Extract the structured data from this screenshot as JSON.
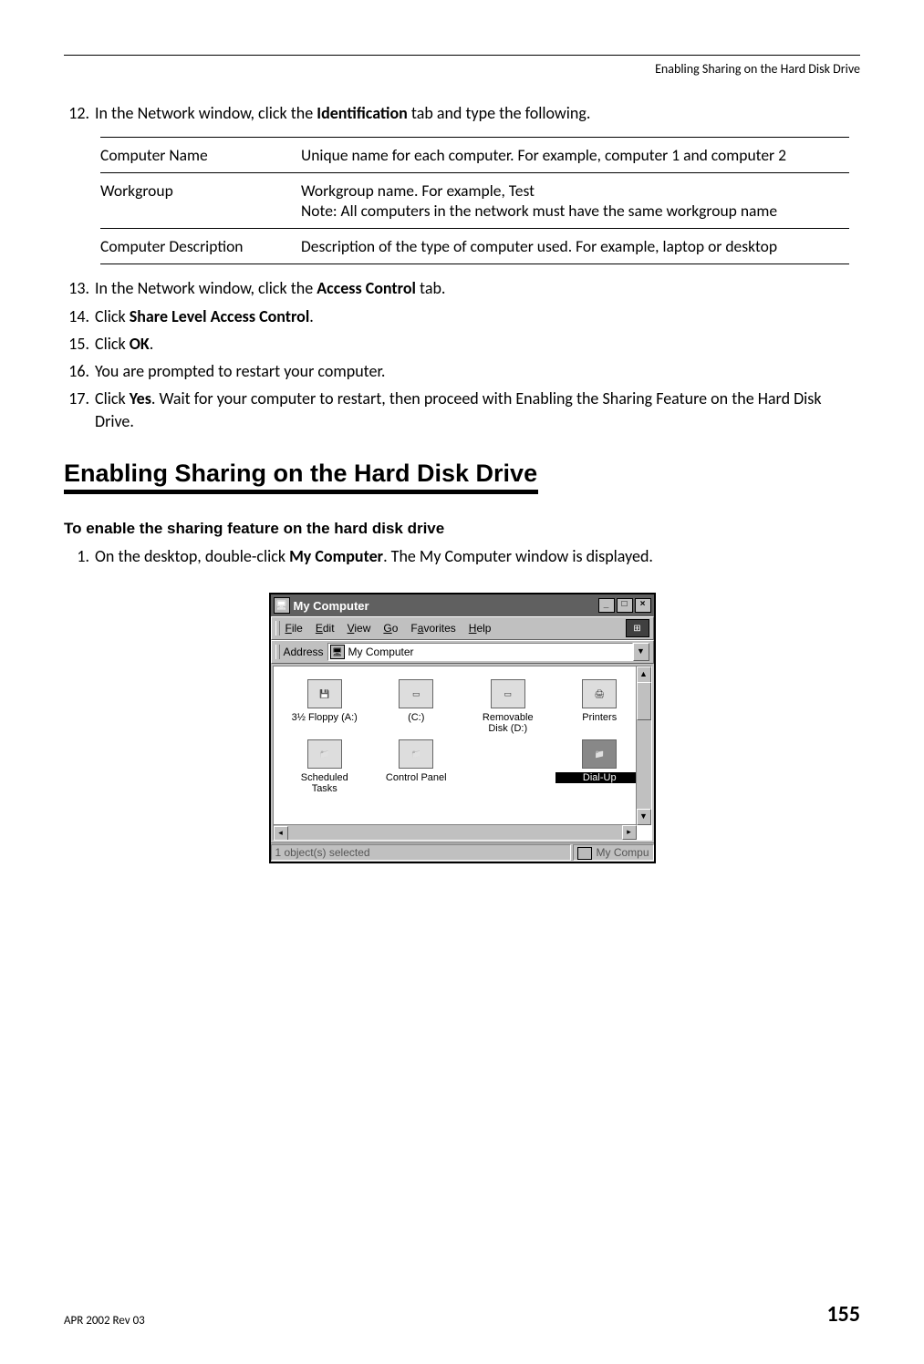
{
  "running_head": "Enabling Sharing on the Hard Disk Drive",
  "steps_a": {
    "n12": "12.",
    "t12_pre": "In the Network window, click the ",
    "t12_bold": "Identification",
    "t12_post": " tab and type the following."
  },
  "table": {
    "r1c1": "Computer Name",
    "r1c2": "Unique name for each computer. For example, computer 1 and computer 2",
    "r2c1": "Workgroup",
    "r2c2": "Workgroup name. For example, Test\nNote: All computers in the network must have the same workgroup name",
    "r3c1": "Computer Description",
    "r3c2": "Description of the type of computer used. For example, laptop or desktop"
  },
  "steps_b": {
    "n13": "13.",
    "t13_pre": "In the Network window, click the ",
    "t13_bold": "Access Control",
    "t13_post": " tab.",
    "n14": "14.",
    "t14_pre": "Click ",
    "t14_bold": "Share Level Access Control",
    "t14_post": ".",
    "n15": "15.",
    "t15_pre": "Click ",
    "t15_bold": "OK",
    "t15_post": ".",
    "n16": "16.",
    "t16": "You are prompted to restart your computer.",
    "n17": "17.",
    "t17_pre": "Click ",
    "t17_bold": "Yes",
    "t17_post": ". Wait for your computer to restart, then proceed with Enabling the Sharing Feature on the Hard Disk Drive."
  },
  "section_heading": "Enabling Sharing on the Hard Disk Drive",
  "subhead": "To enable the sharing feature on the hard disk drive",
  "step1": {
    "n": "1.",
    "pre": "On the desktop, double-click ",
    "bold": "My Computer",
    "post": ". The My Computer window is displayed."
  },
  "window": {
    "title": "My Computer",
    "menus": {
      "file": "File",
      "edit": "Edit",
      "view": "View",
      "go": "Go",
      "fav": "Favorites",
      "help": "Help"
    },
    "address_label": "Address",
    "address_value": "My Computer",
    "icons": {
      "floppy": "3½ Floppy (A:)",
      "c": "(C:)",
      "removable_l1": "Removable",
      "removable_l2": "Disk (D:)",
      "printers": "Printers",
      "scheduled_l1": "Scheduled",
      "scheduled_l2": "Tasks",
      "cpanel": "Control Panel",
      "dialup": "Dial-Up"
    },
    "status_left": "1 object(s) selected",
    "status_right": "My Compu"
  },
  "footer": {
    "rev": "APR 2002 Rev 03",
    "page": "155"
  }
}
